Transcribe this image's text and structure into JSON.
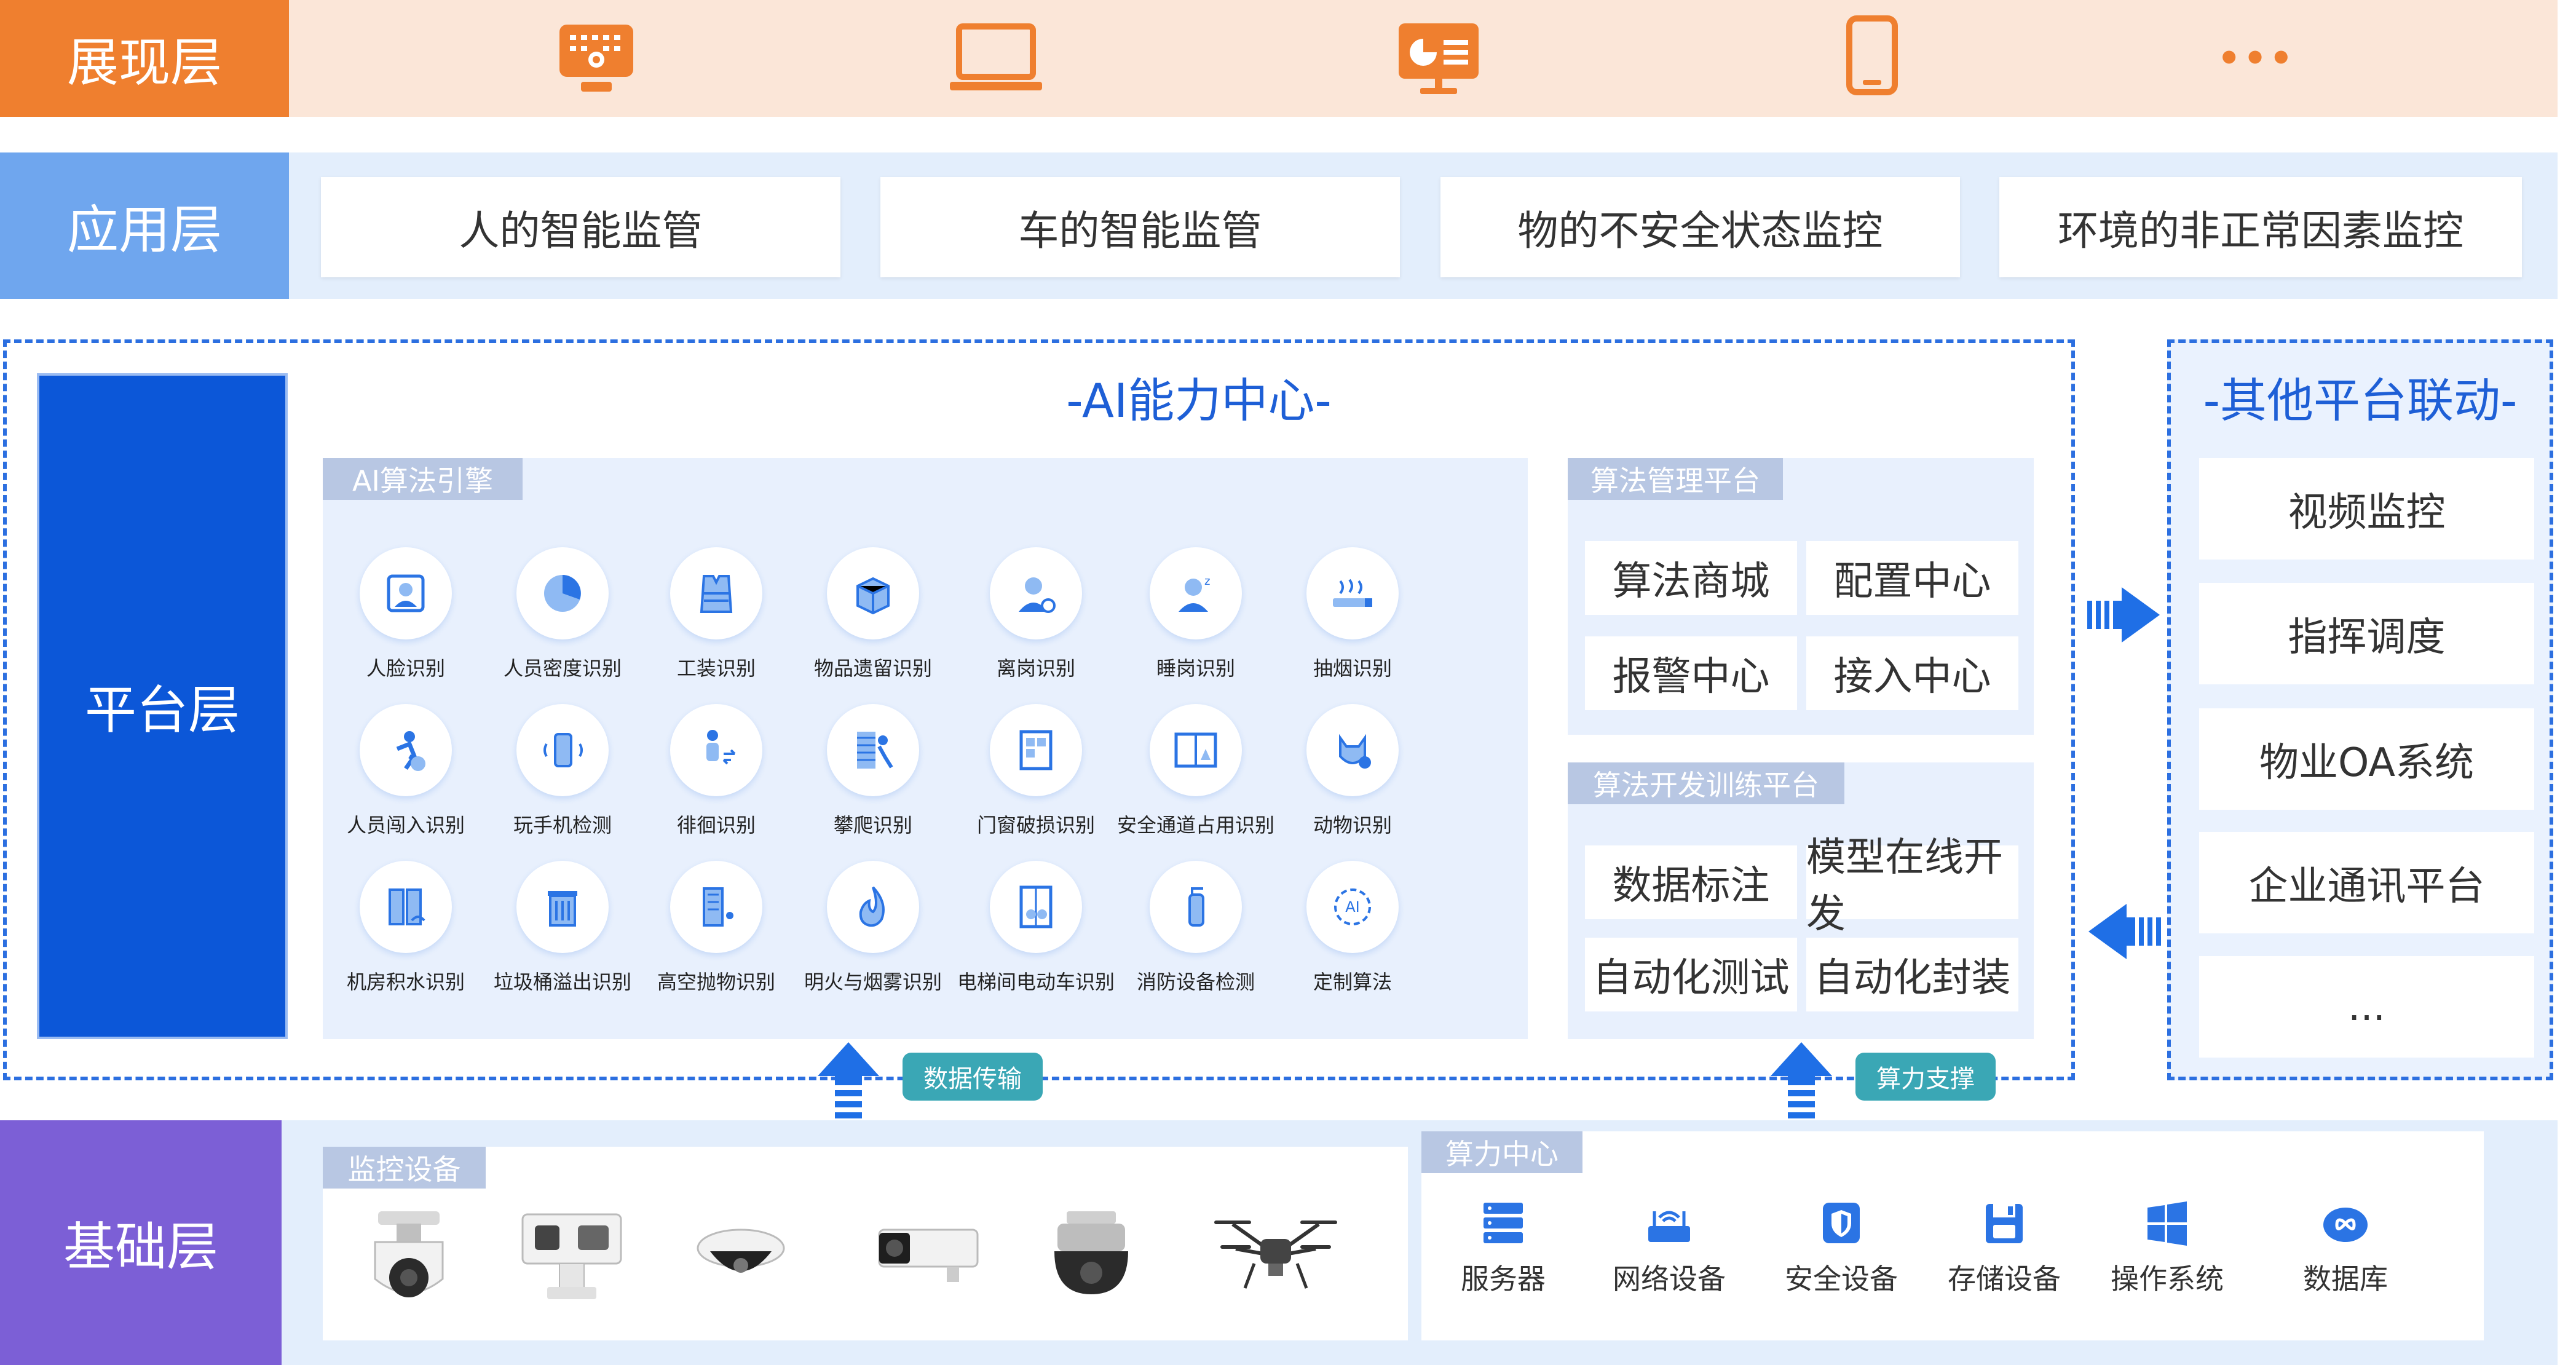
{
  "layers": {
    "presentation": "展现层",
    "application": "应用层",
    "platform": "平台层",
    "foundation": "基础层"
  },
  "presentation": {
    "icons": [
      "video-wall-icon",
      "laptop-icon",
      "presentation-board-icon",
      "mobile-phone-icon",
      "more-icon"
    ],
    "more_text": "•••"
  },
  "application": {
    "cards": [
      "人的智能监管",
      "车的智能监管",
      "物的不安全状态监控",
      "环境的非正常因素监控"
    ]
  },
  "ai_center": {
    "title": "-AI能力中心-",
    "engine": {
      "tag": "AI算法引擎",
      "items": [
        "人脸识别",
        "人员密度识别",
        "工装识别",
        "物品遗留识别",
        "离岗识别",
        "睡岗识别",
        "抽烟识别",
        "人员闯入识别",
        "玩手机检测",
        "徘徊识别",
        "攀爬识别",
        "门窗破损识别",
        "安全通道占用识别",
        "动物识别",
        "机房积水识别",
        "垃圾桶溢出识别",
        "高空抛物识别",
        "明火与烟雾识别",
        "电梯间电动车识别",
        "消防设备检测",
        "定制算法"
      ]
    },
    "management": {
      "tag": "算法管理平台",
      "cards": [
        "算法商城",
        "配置中心",
        "报警中心",
        "接入中心"
      ]
    },
    "training": {
      "tag": "算法开发训练平台",
      "cards": [
        "数据标注",
        "模型在线开发",
        "自动化测试",
        "自动化封装"
      ]
    }
  },
  "other_platforms": {
    "title": "-其他平台联动-",
    "cards": [
      "视频监控",
      "指挥调度",
      "物业OA系统",
      "企业通讯平台",
      "..."
    ]
  },
  "arrows": {
    "data_transfer": "数据传输",
    "compute_support": "算力支撑"
  },
  "foundation": {
    "monitoring": {
      "tag": "监控设备",
      "devices": [
        "ptz-dome-camera",
        "thermal-ptz-camera",
        "dome-camera",
        "bullet-camera",
        "panoramic-camera",
        "drone"
      ]
    },
    "compute": {
      "tag": "算力中心",
      "items": [
        "服务器",
        "网络设备",
        "安全设备",
        "存储设备",
        "操作系统",
        "数据库"
      ]
    }
  },
  "colors": {
    "orange": "#ef7f2f",
    "light_blue": "#6fa6ee",
    "platform_blue": "#0c57d8",
    "purple": "#7c5fd6",
    "dashed": "#2c6fe0",
    "pill_teal": "#3aa7b5"
  }
}
